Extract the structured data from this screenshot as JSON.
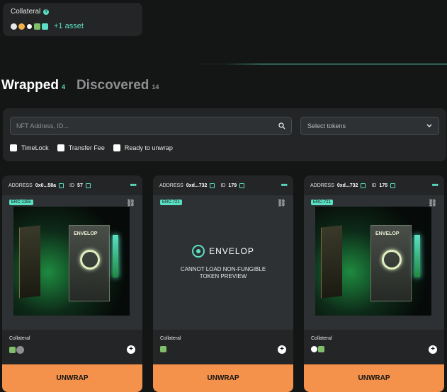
{
  "collateral_summary": {
    "title": "Collateral",
    "help_symbol": "?",
    "more_assets": "+1 asset"
  },
  "tabs": [
    {
      "label": "Wrapped",
      "count": "4"
    },
    {
      "label": "Discovered",
      "count": "14"
    }
  ],
  "filters": {
    "search_placeholder": "NFT Address, ID...",
    "select_placeholder": "Select tokens",
    "checkboxes": [
      {
        "label": "TimeLock"
      },
      {
        "label": "Transfer Fee"
      },
      {
        "label": "Ready to unwrap"
      }
    ]
  },
  "cards": [
    {
      "address_label": "ADDRESS",
      "address": "0x0...58a",
      "id_label": "ID",
      "id": "57",
      "standard": "ERC-1155",
      "collateral_label": "Collateral",
      "unwrap_label": "UNWRAP",
      "image_brand": "ENVELOP"
    },
    {
      "address_label": "ADDRESS",
      "address": "0xd...732",
      "id_label": "ID",
      "id": "179",
      "standard": "ERC-721",
      "preview_brand": "ENVELOP",
      "preview_message": "CANNOT LOAD NON-FUNGIBLE TOKEN PREVIEW",
      "collateral_label": "Collateral",
      "unwrap_label": "UNWRAP"
    },
    {
      "address_label": "ADDRESS",
      "address": "0xd...732",
      "id_label": "ID",
      "id": "175",
      "standard": "ERC-721",
      "collateral_label": "Collateral",
      "unwrap_label": "UNWRAP",
      "image_brand": "ENVELOP"
    }
  ],
  "colors": {
    "accent": "#5ce0c4",
    "button": "#f4914a",
    "background": "#141515",
    "panel": "#232526"
  }
}
